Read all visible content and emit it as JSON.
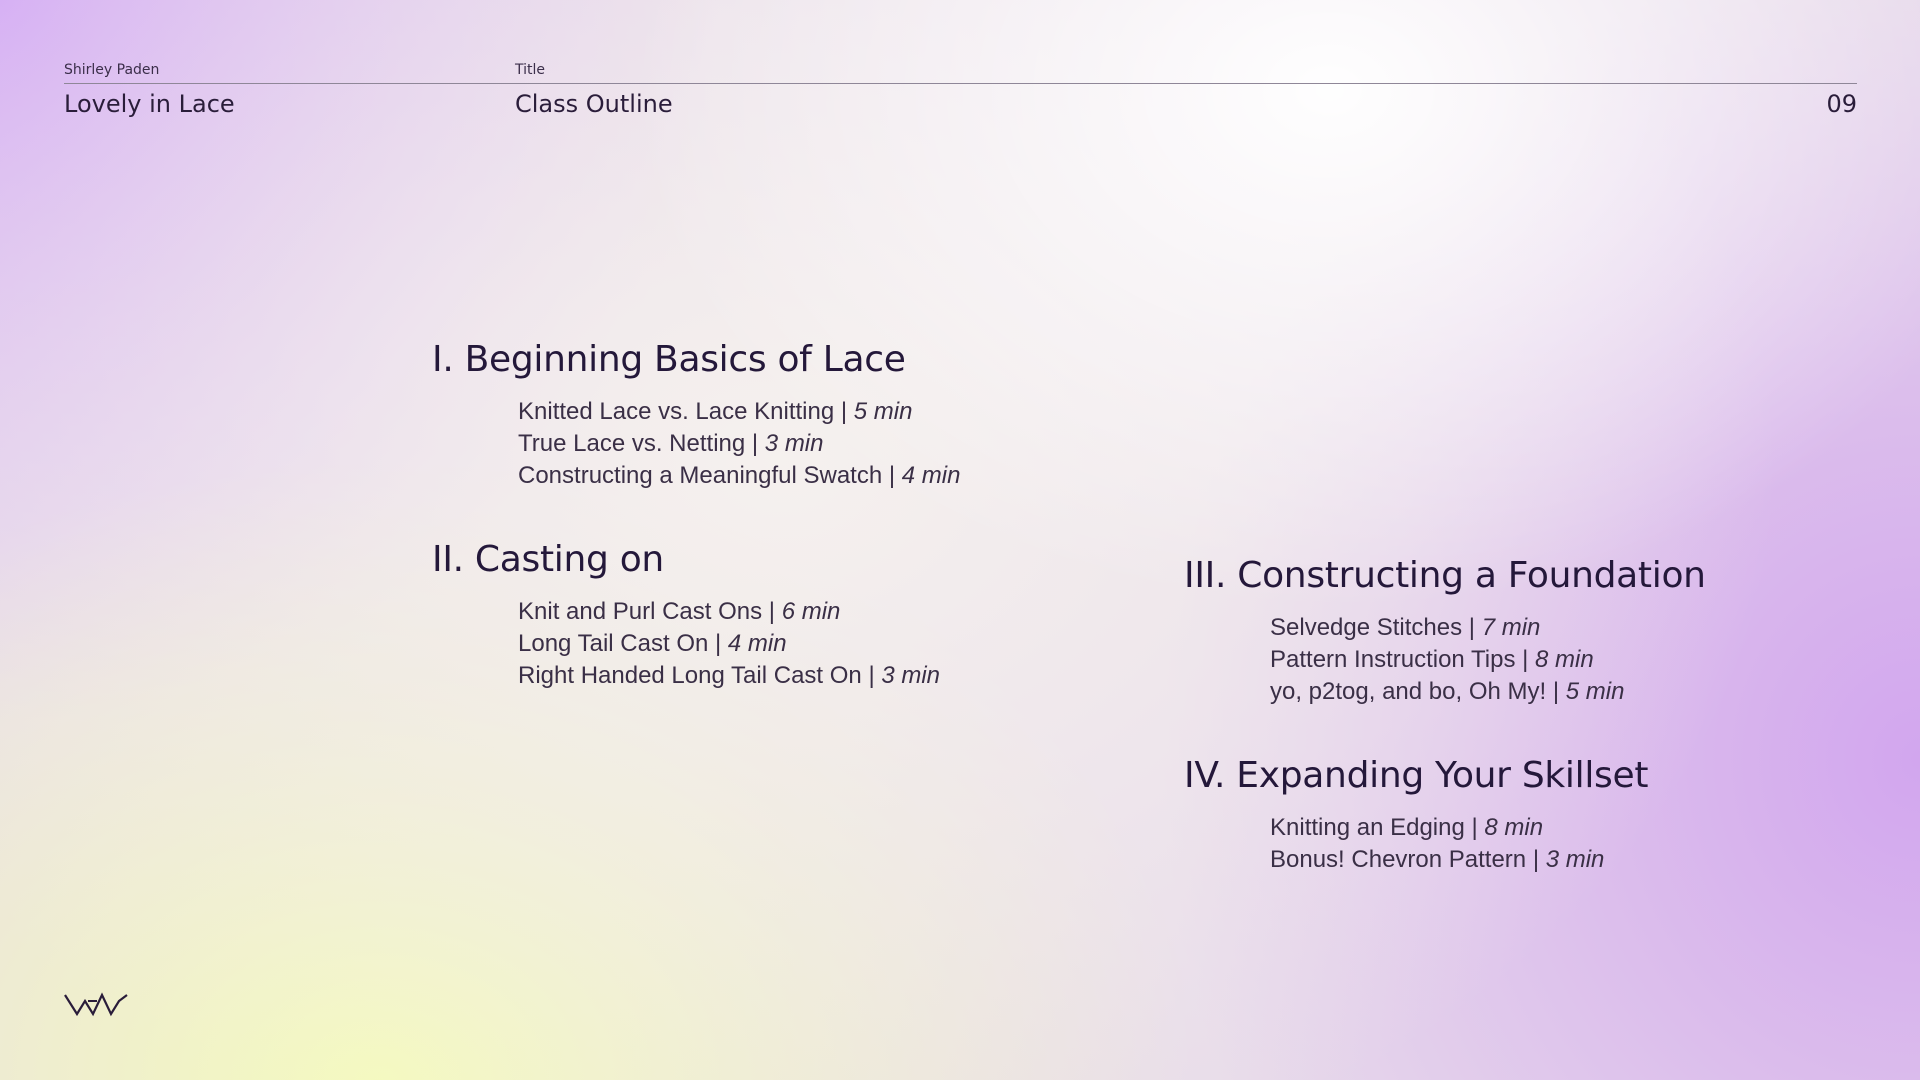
{
  "header": {
    "author_label": "Shirley Paden",
    "course": "Lovely in Lace",
    "title_label": "Title",
    "title": "Class Outline",
    "page_number": "09"
  },
  "sections": [
    {
      "title": "I. Beginning Basics of Lace",
      "items": [
        {
          "text": "Knitted Lace vs. Lace Knitting | ",
          "duration": "5 min"
        },
        {
          "text": "True Lace vs. Netting | ",
          "duration": "3 min"
        },
        {
          "text": "Constructing a Meaningful Swatch | ",
          "duration": "4 min"
        }
      ]
    },
    {
      "title": "II. Casting on",
      "items": [
        {
          "text": "Knit and Purl Cast Ons | ",
          "duration": "6 min"
        },
        {
          "text": "Long Tail Cast On | ",
          "duration": "4 min"
        },
        {
          "text": "Right Handed Long Tail Cast On | ",
          "duration": "3 min"
        }
      ]
    },
    {
      "title": "III. Constructing a Foundation",
      "items": [
        {
          "text": "Selvedge Stitches | ",
          "duration": "7 min"
        },
        {
          "text": "Pattern Instruction Tips | ",
          "duration": "8 min"
        },
        {
          "text": "yo, p2tog, and bo, Oh My! | ",
          "duration": "5 min"
        }
      ]
    },
    {
      "title": "IV. Expanding Your Skillset",
      "items": [
        {
          "text": "Knitting an Edging | ",
          "duration": "8 min"
        },
        {
          "text": "Bonus! Chevron Pattern | ",
          "duration": "3 min"
        }
      ]
    }
  ],
  "logo": {
    "icon": "vav-logo-icon"
  }
}
